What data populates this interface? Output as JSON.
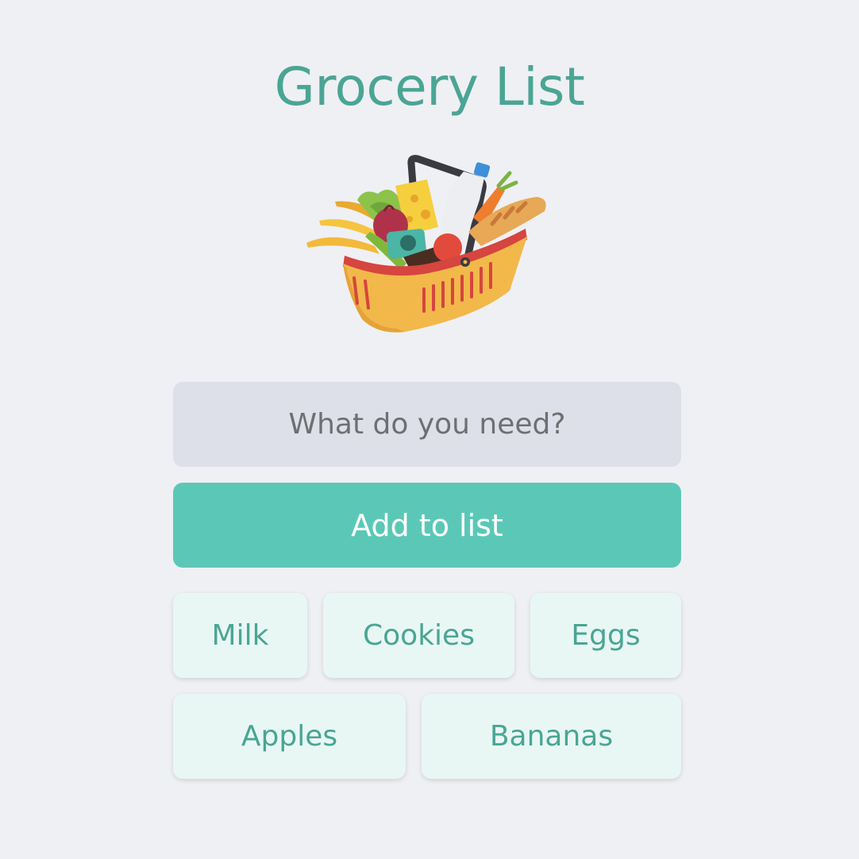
{
  "header": {
    "title": "Grocery List"
  },
  "illustration": {
    "icon": "grocery-basket-icon"
  },
  "form": {
    "input_placeholder": "What do you need?",
    "input_value": "",
    "add_button_label": "Add to list"
  },
  "items": [
    {
      "label": "Milk"
    },
    {
      "label": "Cookies"
    },
    {
      "label": "Eggs"
    },
    {
      "label": "Apples"
    },
    {
      "label": "Bananas"
    }
  ],
  "colors": {
    "background": "#eff0f4",
    "accent": "#5bc8b7",
    "title": "#4aa594",
    "input_bg": "#dde0e8",
    "chip_bg": "#e8f7f4"
  }
}
